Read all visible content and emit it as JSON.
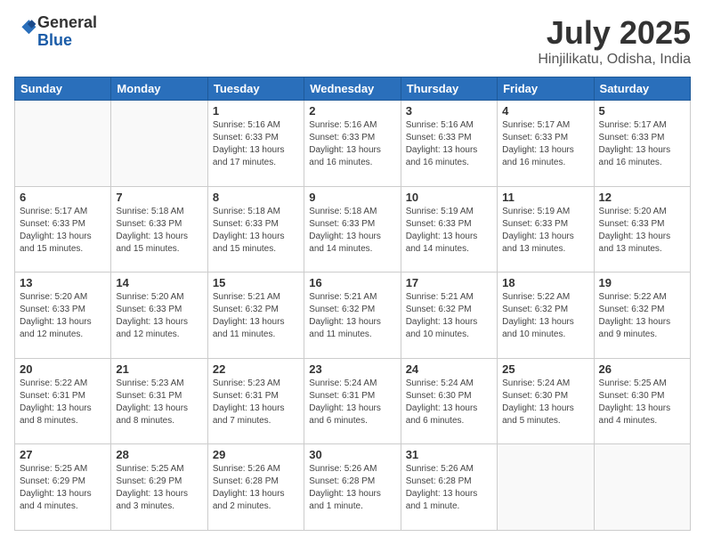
{
  "header": {
    "logo_general": "General",
    "logo_blue": "Blue",
    "title": "July 2025",
    "subtitle": "Hinjilikatu, Odisha, India"
  },
  "weekdays": [
    "Sunday",
    "Monday",
    "Tuesday",
    "Wednesday",
    "Thursday",
    "Friday",
    "Saturday"
  ],
  "weeks": [
    [
      {
        "day": "",
        "info": ""
      },
      {
        "day": "",
        "info": ""
      },
      {
        "day": "1",
        "info": "Sunrise: 5:16 AM\nSunset: 6:33 PM\nDaylight: 13 hours\nand 17 minutes."
      },
      {
        "day": "2",
        "info": "Sunrise: 5:16 AM\nSunset: 6:33 PM\nDaylight: 13 hours\nand 16 minutes."
      },
      {
        "day": "3",
        "info": "Sunrise: 5:16 AM\nSunset: 6:33 PM\nDaylight: 13 hours\nand 16 minutes."
      },
      {
        "day": "4",
        "info": "Sunrise: 5:17 AM\nSunset: 6:33 PM\nDaylight: 13 hours\nand 16 minutes."
      },
      {
        "day": "5",
        "info": "Sunrise: 5:17 AM\nSunset: 6:33 PM\nDaylight: 13 hours\nand 16 minutes."
      }
    ],
    [
      {
        "day": "6",
        "info": "Sunrise: 5:17 AM\nSunset: 6:33 PM\nDaylight: 13 hours\nand 15 minutes."
      },
      {
        "day": "7",
        "info": "Sunrise: 5:18 AM\nSunset: 6:33 PM\nDaylight: 13 hours\nand 15 minutes."
      },
      {
        "day": "8",
        "info": "Sunrise: 5:18 AM\nSunset: 6:33 PM\nDaylight: 13 hours\nand 15 minutes."
      },
      {
        "day": "9",
        "info": "Sunrise: 5:18 AM\nSunset: 6:33 PM\nDaylight: 13 hours\nand 14 minutes."
      },
      {
        "day": "10",
        "info": "Sunrise: 5:19 AM\nSunset: 6:33 PM\nDaylight: 13 hours\nand 14 minutes."
      },
      {
        "day": "11",
        "info": "Sunrise: 5:19 AM\nSunset: 6:33 PM\nDaylight: 13 hours\nand 13 minutes."
      },
      {
        "day": "12",
        "info": "Sunrise: 5:20 AM\nSunset: 6:33 PM\nDaylight: 13 hours\nand 13 minutes."
      }
    ],
    [
      {
        "day": "13",
        "info": "Sunrise: 5:20 AM\nSunset: 6:33 PM\nDaylight: 13 hours\nand 12 minutes."
      },
      {
        "day": "14",
        "info": "Sunrise: 5:20 AM\nSunset: 6:33 PM\nDaylight: 13 hours\nand 12 minutes."
      },
      {
        "day": "15",
        "info": "Sunrise: 5:21 AM\nSunset: 6:32 PM\nDaylight: 13 hours\nand 11 minutes."
      },
      {
        "day": "16",
        "info": "Sunrise: 5:21 AM\nSunset: 6:32 PM\nDaylight: 13 hours\nand 11 minutes."
      },
      {
        "day": "17",
        "info": "Sunrise: 5:21 AM\nSunset: 6:32 PM\nDaylight: 13 hours\nand 10 minutes."
      },
      {
        "day": "18",
        "info": "Sunrise: 5:22 AM\nSunset: 6:32 PM\nDaylight: 13 hours\nand 10 minutes."
      },
      {
        "day": "19",
        "info": "Sunrise: 5:22 AM\nSunset: 6:32 PM\nDaylight: 13 hours\nand 9 minutes."
      }
    ],
    [
      {
        "day": "20",
        "info": "Sunrise: 5:22 AM\nSunset: 6:31 PM\nDaylight: 13 hours\nand 8 minutes."
      },
      {
        "day": "21",
        "info": "Sunrise: 5:23 AM\nSunset: 6:31 PM\nDaylight: 13 hours\nand 8 minutes."
      },
      {
        "day": "22",
        "info": "Sunrise: 5:23 AM\nSunset: 6:31 PM\nDaylight: 13 hours\nand 7 minutes."
      },
      {
        "day": "23",
        "info": "Sunrise: 5:24 AM\nSunset: 6:31 PM\nDaylight: 13 hours\nand 6 minutes."
      },
      {
        "day": "24",
        "info": "Sunrise: 5:24 AM\nSunset: 6:30 PM\nDaylight: 13 hours\nand 6 minutes."
      },
      {
        "day": "25",
        "info": "Sunrise: 5:24 AM\nSunset: 6:30 PM\nDaylight: 13 hours\nand 5 minutes."
      },
      {
        "day": "26",
        "info": "Sunrise: 5:25 AM\nSunset: 6:30 PM\nDaylight: 13 hours\nand 4 minutes."
      }
    ],
    [
      {
        "day": "27",
        "info": "Sunrise: 5:25 AM\nSunset: 6:29 PM\nDaylight: 13 hours\nand 4 minutes."
      },
      {
        "day": "28",
        "info": "Sunrise: 5:25 AM\nSunset: 6:29 PM\nDaylight: 13 hours\nand 3 minutes."
      },
      {
        "day": "29",
        "info": "Sunrise: 5:26 AM\nSunset: 6:28 PM\nDaylight: 13 hours\nand 2 minutes."
      },
      {
        "day": "30",
        "info": "Sunrise: 5:26 AM\nSunset: 6:28 PM\nDaylight: 13 hours\nand 1 minute."
      },
      {
        "day": "31",
        "info": "Sunrise: 5:26 AM\nSunset: 6:28 PM\nDaylight: 13 hours\nand 1 minute."
      },
      {
        "day": "",
        "info": ""
      },
      {
        "day": "",
        "info": ""
      }
    ]
  ]
}
